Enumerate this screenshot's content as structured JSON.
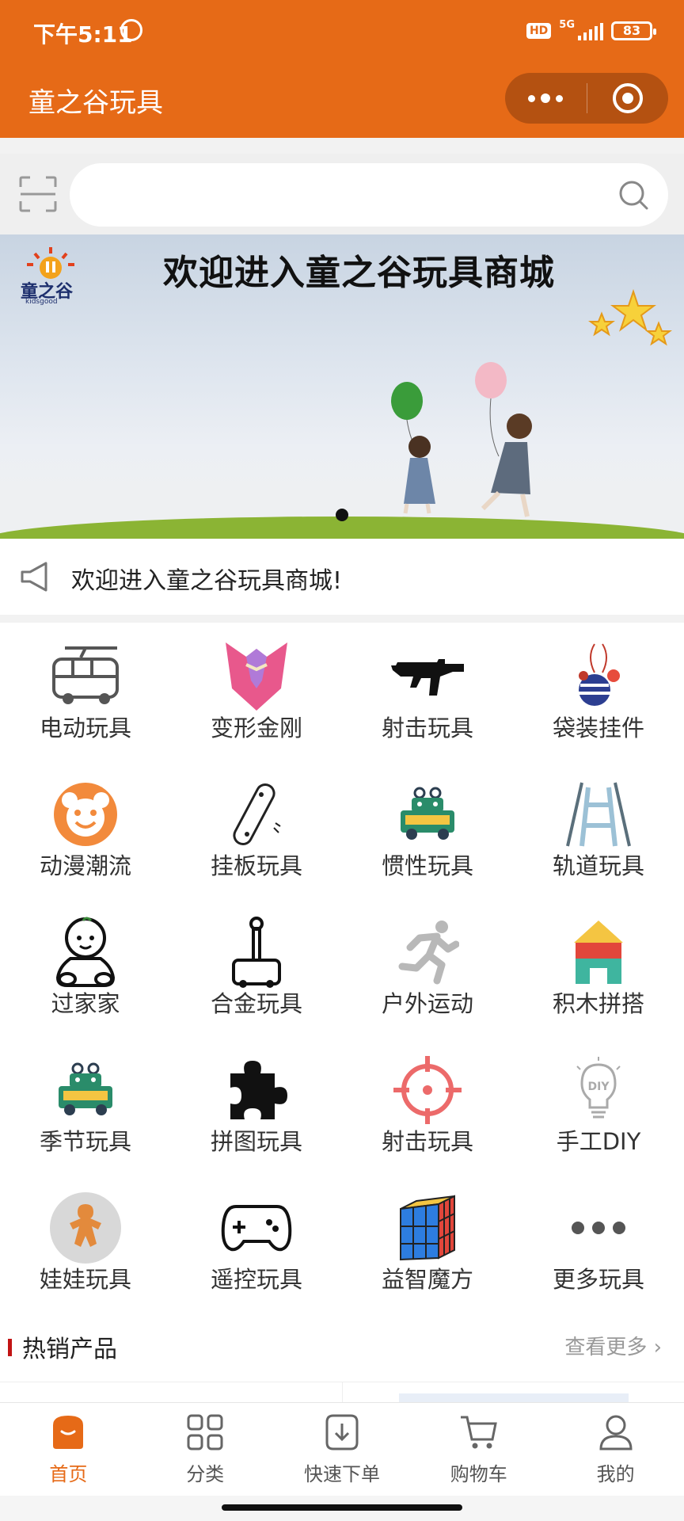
{
  "status_bar": {
    "time": "下午5:11",
    "network": "5G",
    "hd": "HD",
    "battery": "83"
  },
  "header": {
    "title": "童之谷玩具"
  },
  "search": {
    "placeholder": ""
  },
  "banner": {
    "title": "欢迎进入童之谷玩具商城",
    "logo_text": "童之谷",
    "logo_sub": "kidsgood",
    "active_slide": 1,
    "slide_count": 1
  },
  "notice": {
    "text": "欢迎进入童之谷玩具商城!"
  },
  "categories": [
    {
      "label": "电动玩具",
      "icon": "bus-icon"
    },
    {
      "label": "变形金刚",
      "icon": "transformer-icon"
    },
    {
      "label": "射击玩具",
      "icon": "rifle-icon"
    },
    {
      "label": "袋装挂件",
      "icon": "ornament-icon"
    },
    {
      "label": "动漫潮流",
      "icon": "bear-face-icon"
    },
    {
      "label": "挂板玩具",
      "icon": "skateboard-icon"
    },
    {
      "label": "惯性玩具",
      "icon": "robot-car-icon"
    },
    {
      "label": "轨道玩具",
      "icon": "ladder-track-icon"
    },
    {
      "label": "过家家",
      "icon": "baby-icon"
    },
    {
      "label": "合金玩具",
      "icon": "joystick-icon"
    },
    {
      "label": "户外运动",
      "icon": "runner-icon"
    },
    {
      "label": "积木拼搭",
      "icon": "blocks-icon"
    },
    {
      "label": "季节玩具",
      "icon": "robot-car-icon"
    },
    {
      "label": "拼图玩具",
      "icon": "puzzle-icon"
    },
    {
      "label": "射击玩具",
      "icon": "crosshair-icon"
    },
    {
      "label": "手工DIY",
      "icon": "diy-bulb-icon"
    },
    {
      "label": "娃娃玩具",
      "icon": "gingerbread-icon"
    },
    {
      "label": "遥控玩具",
      "icon": "gamepad-icon"
    },
    {
      "label": "益智魔方",
      "icon": "rubiks-cube-icon"
    },
    {
      "label": "更多玩具",
      "icon": "more-dots-icon"
    }
  ],
  "hot": {
    "title": "热销产品",
    "more": "查看更多"
  },
  "tabs": [
    {
      "label": "首页",
      "icon": "home-icon",
      "active": true
    },
    {
      "label": "分类",
      "icon": "grid-icon",
      "active": false
    },
    {
      "label": "快速下单",
      "icon": "download-icon",
      "active": false
    },
    {
      "label": "购物车",
      "icon": "cart-icon",
      "active": false
    },
    {
      "label": "我的",
      "icon": "user-icon",
      "active": false
    }
  ],
  "colors": {
    "brand": "#e66a17",
    "hot_bar": "#c21414"
  }
}
